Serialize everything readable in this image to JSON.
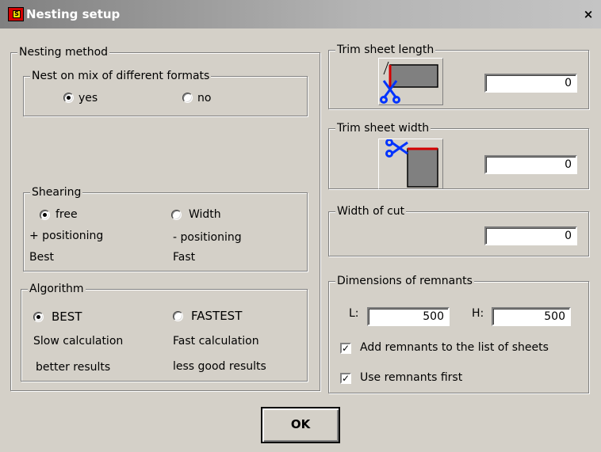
{
  "window": {
    "title": "Nesting setup",
    "close_symbol": "×",
    "icon_letter": "S"
  },
  "nesting_method": {
    "legend": "Nesting method",
    "mix_formats": {
      "legend": "Nest on mix of different formats",
      "yes": "yes",
      "no": "no",
      "selected": "yes"
    },
    "shearing": {
      "legend": "Shearing",
      "free": "free",
      "free_desc1": "+ positioning",
      "free_desc2": "Best",
      "width": "Width",
      "width_desc1": "- positioning",
      "width_desc2": "Fast",
      "selected": "free"
    },
    "algorithm": {
      "legend": "Algorithm",
      "best": "BEST",
      "best_desc1": "Slow calculation",
      "best_desc2": "better results",
      "fastest": "FASTEST",
      "fastest_desc1": "Fast calculation",
      "fastest_desc2": "less good results",
      "selected": "BEST"
    }
  },
  "trim_length": {
    "legend": "Trim sheet length",
    "value": "0"
  },
  "trim_width": {
    "legend": "Trim sheet width",
    "value": "0"
  },
  "width_of_cut": {
    "legend": "Width of cut",
    "value": "0"
  },
  "remnants": {
    "legend": "Dimensions of remnants",
    "l_label": "L:",
    "l_value": "500",
    "h_label": "H:",
    "h_value": "500",
    "add_to_list": "Add remnants to the list of sheets",
    "add_checked": true,
    "use_first": "Use remnants first",
    "use_checked": true
  },
  "ok_label": "OK"
}
